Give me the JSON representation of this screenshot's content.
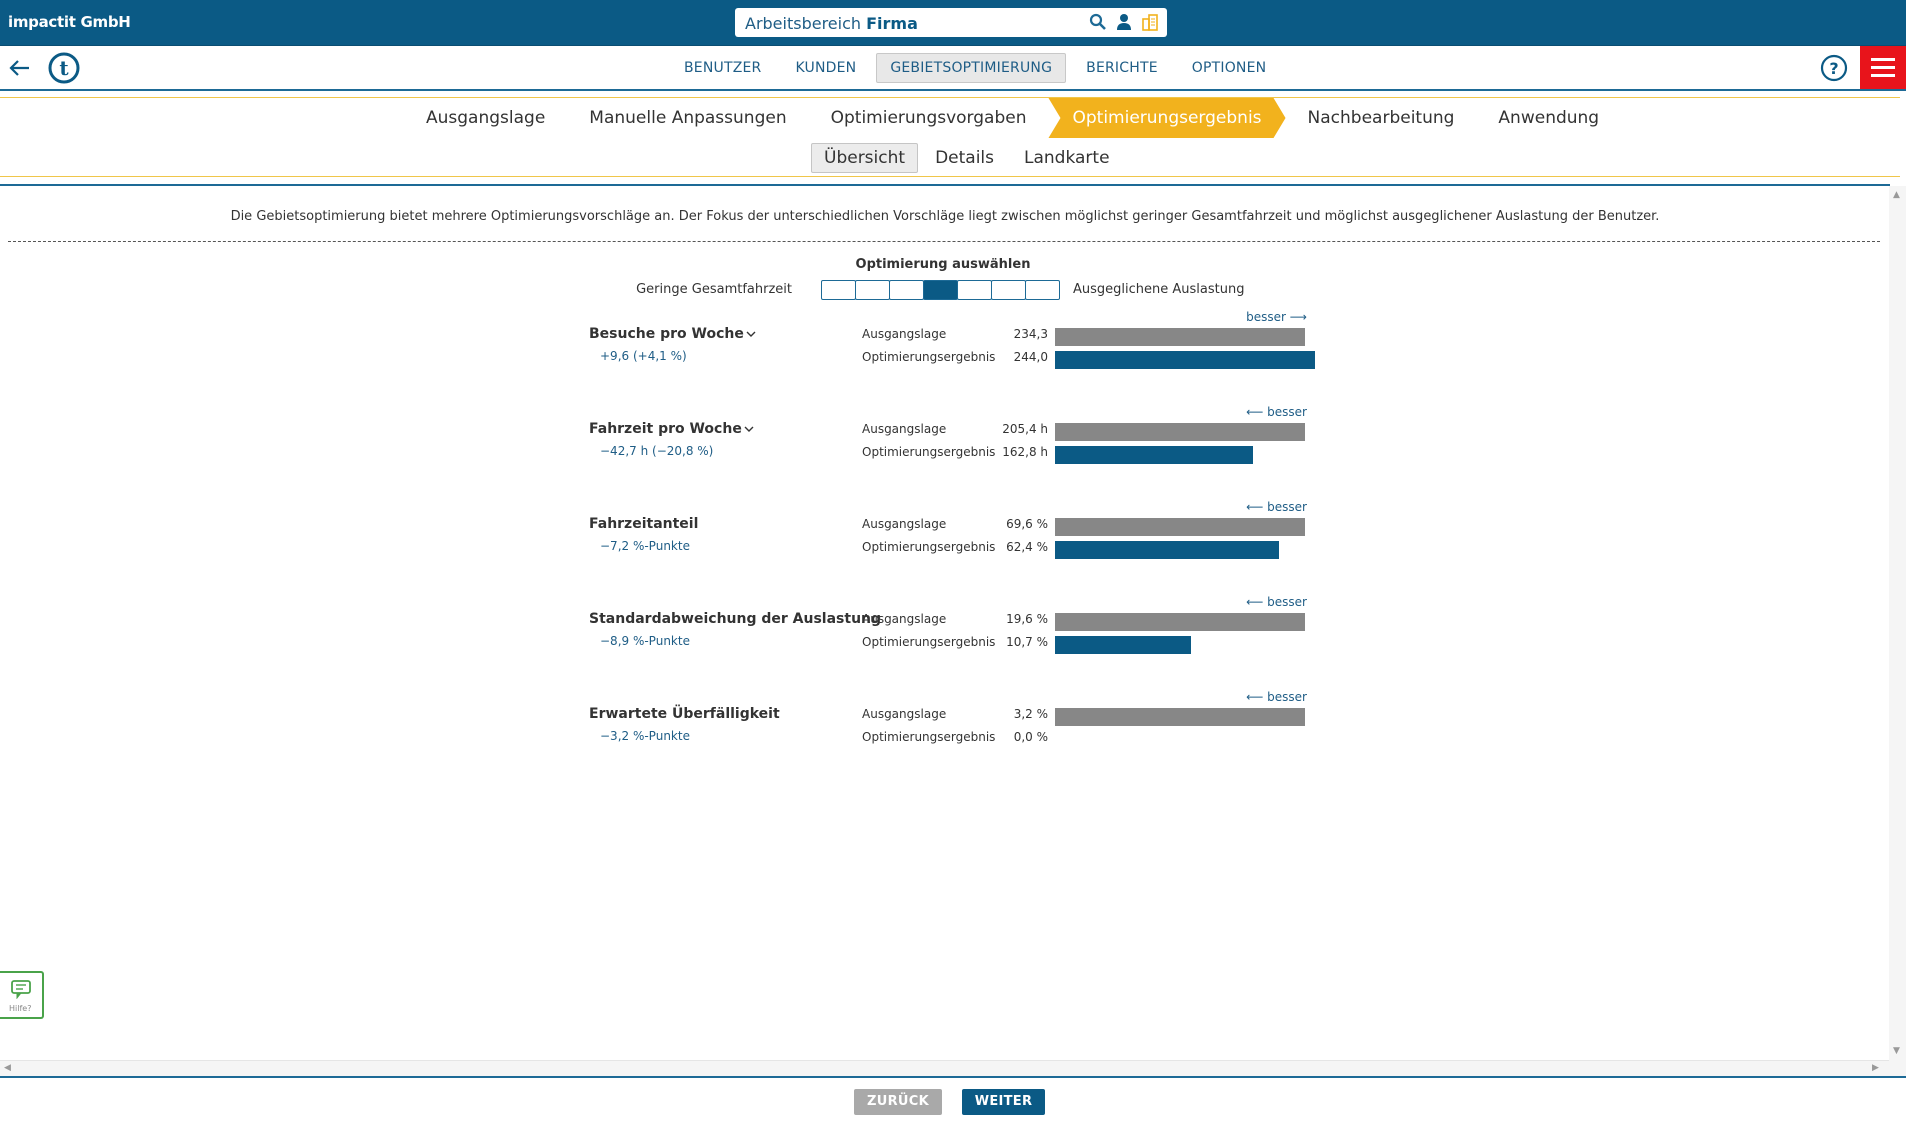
{
  "company": "impactit GmbH",
  "workspace": {
    "prefix": "Arbeitsbereich",
    "name": "Firma"
  },
  "nav": {
    "items": [
      "BENUTZER",
      "KUNDEN",
      "GEBIETSOPTIMIERUNG",
      "BERICHTE",
      "OPTIONEN"
    ],
    "active": "GEBIETSOPTIMIERUNG"
  },
  "steps": {
    "items": [
      "Ausgangslage",
      "Manuelle Anpassungen",
      "Optimierungsvorgaben",
      "Optimierungsergebnis",
      "Nachbearbeitung",
      "Anwendung"
    ],
    "active": "Optimierungsergebnis"
  },
  "subtabs": {
    "items": [
      "Übersicht",
      "Details",
      "Landkarte"
    ],
    "active": "Übersicht"
  },
  "intro": "Die Gebietsoptimierung bietet mehrere Optimierungsvorschläge an. Der Fokus der unterschiedlichen Vorschläge liegt zwischen möglichst geringer Gesamtfahrzeit und möglichst ausgeglichener Auslastung der Benutzer.",
  "selector": {
    "title": "Optimierung auswählen",
    "left_label": "Geringe Gesamtfahrzeit",
    "right_label": "Ausgeglichene Auslastung",
    "steps": 7,
    "selected_index": 3
  },
  "row_labels": {
    "base": "Ausgangslage",
    "opt": "Optimierungsergebnis"
  },
  "metrics": [
    {
      "title": "Besuche pro Woche",
      "expandable": true,
      "delta": "+9,6 (+4,1 %)",
      "besser": "besser ⟶",
      "base_value": "234,3",
      "opt_value": "244,0",
      "base_ratio": 1.0,
      "opt_ratio": 1.041
    },
    {
      "title": "Fahrzeit pro Woche",
      "expandable": true,
      "delta": "−42,7 h (−20,8 %)",
      "besser": "⟵ besser",
      "base_value": "205,4 h",
      "opt_value": "162,8 h",
      "base_ratio": 1.0,
      "opt_ratio": 0.7926
    },
    {
      "title": "Fahrzeitanteil",
      "expandable": false,
      "delta": "−7,2 %-Punkte",
      "besser": "⟵ besser",
      "base_value": "69,6 %",
      "opt_value": "62,4 %",
      "base_ratio": 1.0,
      "opt_ratio": 0.8966
    },
    {
      "title": "Standardabweichung der Auslastung",
      "expandable": false,
      "delta": "−8,9 %-Punkte",
      "besser": "⟵ besser",
      "base_value": "19,6 %",
      "opt_value": "10,7 %",
      "base_ratio": 1.0,
      "opt_ratio": 0.5459
    },
    {
      "title": "Erwartete Überfälligkeit",
      "expandable": false,
      "delta": "−3,2 %-Punkte",
      "besser": "⟵ besser",
      "base_value": "3,2 %",
      "opt_value": "0,0 %",
      "base_ratio": 1.0,
      "opt_ratio": 0.0
    }
  ],
  "buttons": {
    "back": "ZURÜCK",
    "next": "WEITER"
  },
  "help_label": "Hilfe?",
  "colors": {
    "primary": "#0b5a85",
    "accent": "#f2b21d",
    "bar_base": "#878787",
    "menu": "#e8141b",
    "help": "#4aa34a"
  }
}
